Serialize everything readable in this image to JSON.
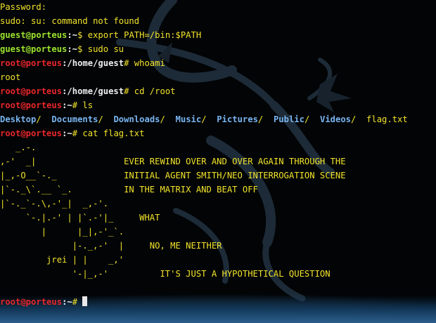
{
  "terminal": {
    "prompts": {
      "guest_user": "guest@porteus",
      "root_user": "root@porteus",
      "home_path": "~",
      "guest_home_path": "/home/guest",
      "dollar": "$",
      "hash": "#"
    },
    "lines": [
      {
        "segments": [
          {
            "style": "y",
            "text": "Password:"
          }
        ]
      },
      {
        "segments": [
          {
            "style": "y",
            "text": "sudo: su: command not found"
          }
        ]
      },
      {
        "segments": [
          {
            "style": "g",
            "text": "guest@porteus"
          },
          {
            "style": "w",
            "text": ":~"
          },
          {
            "style": "y",
            "text": "$ export PATH=/bin:$PATH"
          }
        ]
      },
      {
        "segments": [
          {
            "style": "g",
            "text": "guest@porteus"
          },
          {
            "style": "w",
            "text": ":~"
          },
          {
            "style": "y",
            "text": "$ sudo su"
          }
        ]
      },
      {
        "segments": [
          {
            "style": "r",
            "text": "root@porteus"
          },
          {
            "style": "w",
            "text": ":/home/guest"
          },
          {
            "style": "y",
            "text": "# whoami"
          }
        ]
      },
      {
        "segments": [
          {
            "style": "y",
            "text": "root"
          }
        ]
      },
      {
        "segments": [
          {
            "style": "r",
            "text": "root@porteus"
          },
          {
            "style": "w",
            "text": ":/home/guest"
          },
          {
            "style": "y",
            "text": "# cd /root"
          }
        ]
      },
      {
        "segments": [
          {
            "style": "r",
            "text": "root@porteus"
          },
          {
            "style": "w",
            "text": ":~"
          },
          {
            "style": "y",
            "text": "# ls"
          }
        ]
      },
      {
        "segments": [
          {
            "style": "b",
            "text": "Desktop"
          },
          {
            "style": "y",
            "text": "/  "
          },
          {
            "style": "b",
            "text": "Documents"
          },
          {
            "style": "y",
            "text": "/  "
          },
          {
            "style": "b",
            "text": "Downloads"
          },
          {
            "style": "y",
            "text": "/  "
          },
          {
            "style": "b",
            "text": "Music"
          },
          {
            "style": "y",
            "text": "/  "
          },
          {
            "style": "b",
            "text": "Pictures"
          },
          {
            "style": "y",
            "text": "/  "
          },
          {
            "style": "b",
            "text": "Public"
          },
          {
            "style": "y",
            "text": "/  "
          },
          {
            "style": "b",
            "text": "Videos"
          },
          {
            "style": "y",
            "text": "/  flag.txt"
          }
        ]
      },
      {
        "segments": [
          {
            "style": "r",
            "text": "root@porteus"
          },
          {
            "style": "w",
            "text": ":~"
          },
          {
            "style": "y",
            "text": "# cat flag.txt"
          }
        ]
      },
      {
        "segments": [
          {
            "style": "y",
            "text": "   _.-."
          }
        ]
      },
      {
        "segments": [
          {
            "style": "y",
            "text": ",-'  _|                 EVER REWIND OVER AND OVER AGAIN THROUGH THE"
          }
        ]
      },
      {
        "segments": [
          {
            "style": "y",
            "text": "|_,-O__`-._             INITIAL AGENT SMITH/NEO INTERROGATION SCENE"
          }
        ]
      },
      {
        "segments": [
          {
            "style": "y",
            "text": "|`-._\\`.__ `_.          IN THE MATRIX AND BEAT OFF"
          }
        ]
      },
      {
        "segments": [
          {
            "style": "y",
            "text": "|`-._`-.\\,-'_|  _,-'."
          }
        ]
      },
      {
        "segments": [
          {
            "style": "y",
            "text": "     `-.|.-' | |`.-'|_     WHAT"
          }
        ]
      },
      {
        "segments": [
          {
            "style": "y",
            "text": "        |      |_|,-'_`."
          }
        ]
      },
      {
        "segments": [
          {
            "style": "y",
            "text": "              |-._,-'  |     NO, ME NEITHER"
          }
        ]
      },
      {
        "segments": [
          {
            "style": "y",
            "text": "         jrei | |    _,'"
          }
        ]
      },
      {
        "segments": [
          {
            "style": "y",
            "text": "              '-|_,-'          IT'S JUST A HYPOTHETICAL QUESTION"
          }
        ]
      },
      {
        "segments": [
          {
            "style": "y",
            "text": ""
          }
        ]
      },
      {
        "segments": [
          {
            "style": "r",
            "text": "root@porteus"
          },
          {
            "style": "w",
            "text": ":~"
          },
          {
            "style": "y",
            "text": "# "
          }
        ],
        "cursor": true
      }
    ]
  },
  "colors": {
    "background": "#020406",
    "output_text": "#f2e32a",
    "guest_prompt": "#9be22d",
    "root_prompt": "#e8262a",
    "path": "#ededed",
    "directory": "#79b4ef",
    "cursor": "#e8e8e8"
  },
  "icons": {
    "background_logo": "dragon-logo-icon"
  }
}
